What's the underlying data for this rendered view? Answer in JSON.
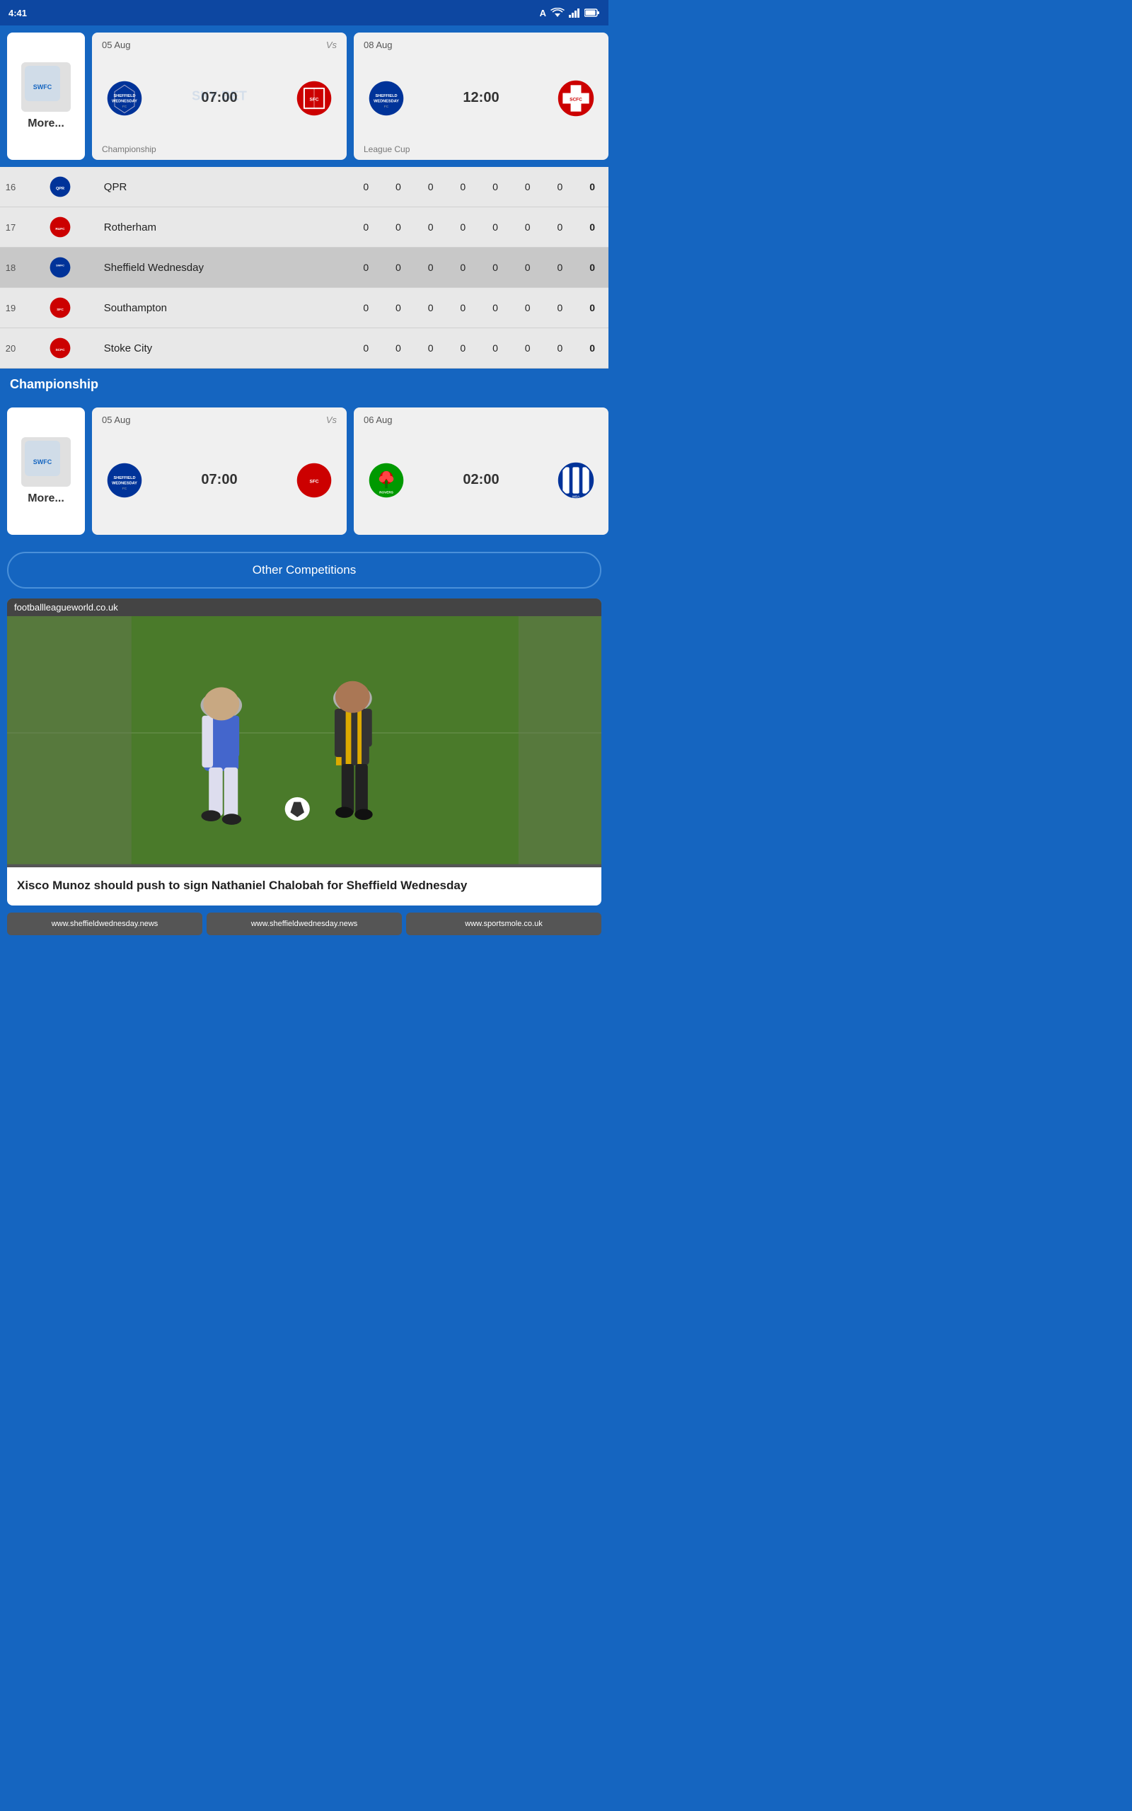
{
  "statusBar": {
    "time": "4:41",
    "wifi": "▲",
    "battery": "🔋"
  },
  "topMatches": {
    "moreLabel": "More...",
    "cards": [
      {
        "date": "05 Aug",
        "vs": "Vs",
        "time": "07:00",
        "competition": "Championship",
        "homeTeam": "Sheffield Wednesday",
        "awayTeam": "Southampton"
      },
      {
        "date": "08 Aug",
        "vs": "",
        "time": "12:00",
        "competition": "League Cup",
        "homeTeam": "Sheffield Wednesday",
        "awayTeam": "Stoke"
      }
    ]
  },
  "leagueTable": {
    "rows": [
      {
        "rank": "16",
        "name": "QPR",
        "col1": "0",
        "col2": "0",
        "col3": "0",
        "col4": "0",
        "col5": "0",
        "col6": "0",
        "col7": "0",
        "points": "0"
      },
      {
        "rank": "17",
        "name": "Rotherham",
        "col1": "0",
        "col2": "0",
        "col3": "0",
        "col4": "0",
        "col5": "0",
        "col6": "0",
        "col7": "0",
        "points": "0"
      },
      {
        "rank": "18",
        "name": "Sheffield Wednesday",
        "col1": "0",
        "col2": "0",
        "col3": "0",
        "col4": "0",
        "col5": "0",
        "col6": "0",
        "col7": "0",
        "points": "0"
      },
      {
        "rank": "19",
        "name": "Southampton",
        "col1": "0",
        "col2": "0",
        "col3": "0",
        "col4": "0",
        "col5": "0",
        "col6": "0",
        "col7": "0",
        "points": "0"
      },
      {
        "rank": "20",
        "name": "Stoke City",
        "col1": "0",
        "col2": "0",
        "col3": "0",
        "col4": "0",
        "col5": "0",
        "col6": "0",
        "col7": "0",
        "points": "0"
      }
    ]
  },
  "champSection": {
    "title": "Championship",
    "moreLabel": "More...",
    "cards": [
      {
        "date": "05 Aug",
        "vs": "Vs",
        "time": "07:00",
        "homeTeam": "Sheffield Wednesday",
        "awayTeam": "Southampton"
      },
      {
        "date": "06 Aug",
        "vs": "",
        "time": "02:00",
        "homeTeam": "Blackburn",
        "awayTeam": "West Brom"
      }
    ]
  },
  "otherCompBtn": "Other Competitions",
  "newsCard": {
    "source": "footballleagueworld.co.uk",
    "title": "Xisco Munoz should push to sign Nathaniel Chalobah for Sheffield Wednesday"
  },
  "bottomLinks": [
    {
      "url": "www.sheffieldwednesday.news"
    },
    {
      "url": "www.sheffieldwednesday.news"
    },
    {
      "url": "www.sportsmole.co.uk"
    }
  ]
}
